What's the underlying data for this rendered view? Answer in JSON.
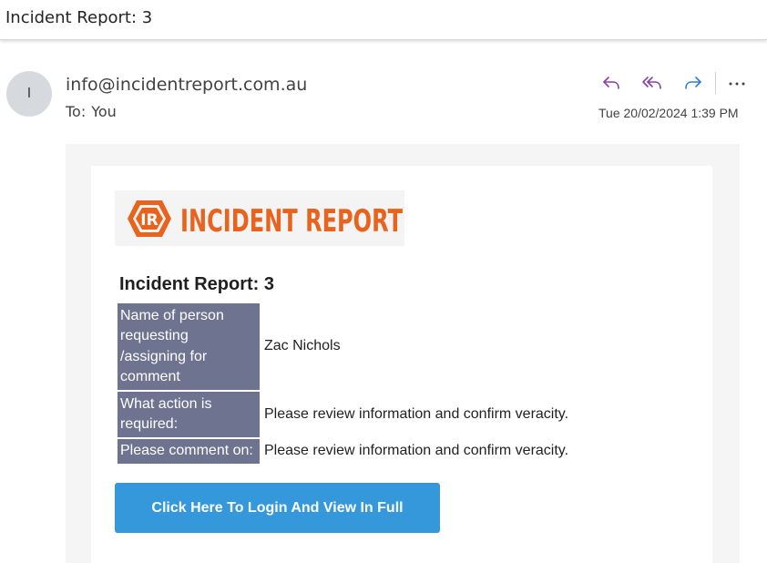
{
  "header": {
    "subject": "Incident Report: 3"
  },
  "message": {
    "avatar_initial": "I",
    "from": "info@incidentreport.com.au",
    "to_label": "To:",
    "to_name": "You",
    "timestamp": "Tue 20/02/2024 1:39 PM",
    "actions": {
      "reply_icon": "reply-icon",
      "reply_all_icon": "reply-all-icon",
      "forward_icon": "forward-icon",
      "more_icon": "more-icon"
    }
  },
  "body": {
    "logo_text": "INCIDENT REPORT",
    "logo_mark": "IR",
    "title": "Incident Report: 3",
    "rows": [
      {
        "label": "Name of person requesting /assigning for comment",
        "value": "Zac Nichols"
      },
      {
        "label": "What action is required:",
        "value": "Please review information and confirm veracity."
      },
      {
        "label": "Please comment on:",
        "value": "Please review information and confirm veracity."
      }
    ],
    "button_label": "Click Here To Login And View In Full"
  },
  "colors": {
    "accent_button": "#3498db",
    "label_cell": "#6e7490",
    "logo_orange": "#e8641e",
    "action_purple": "#8b3fa8",
    "action_blue": "#2f7fd1"
  }
}
